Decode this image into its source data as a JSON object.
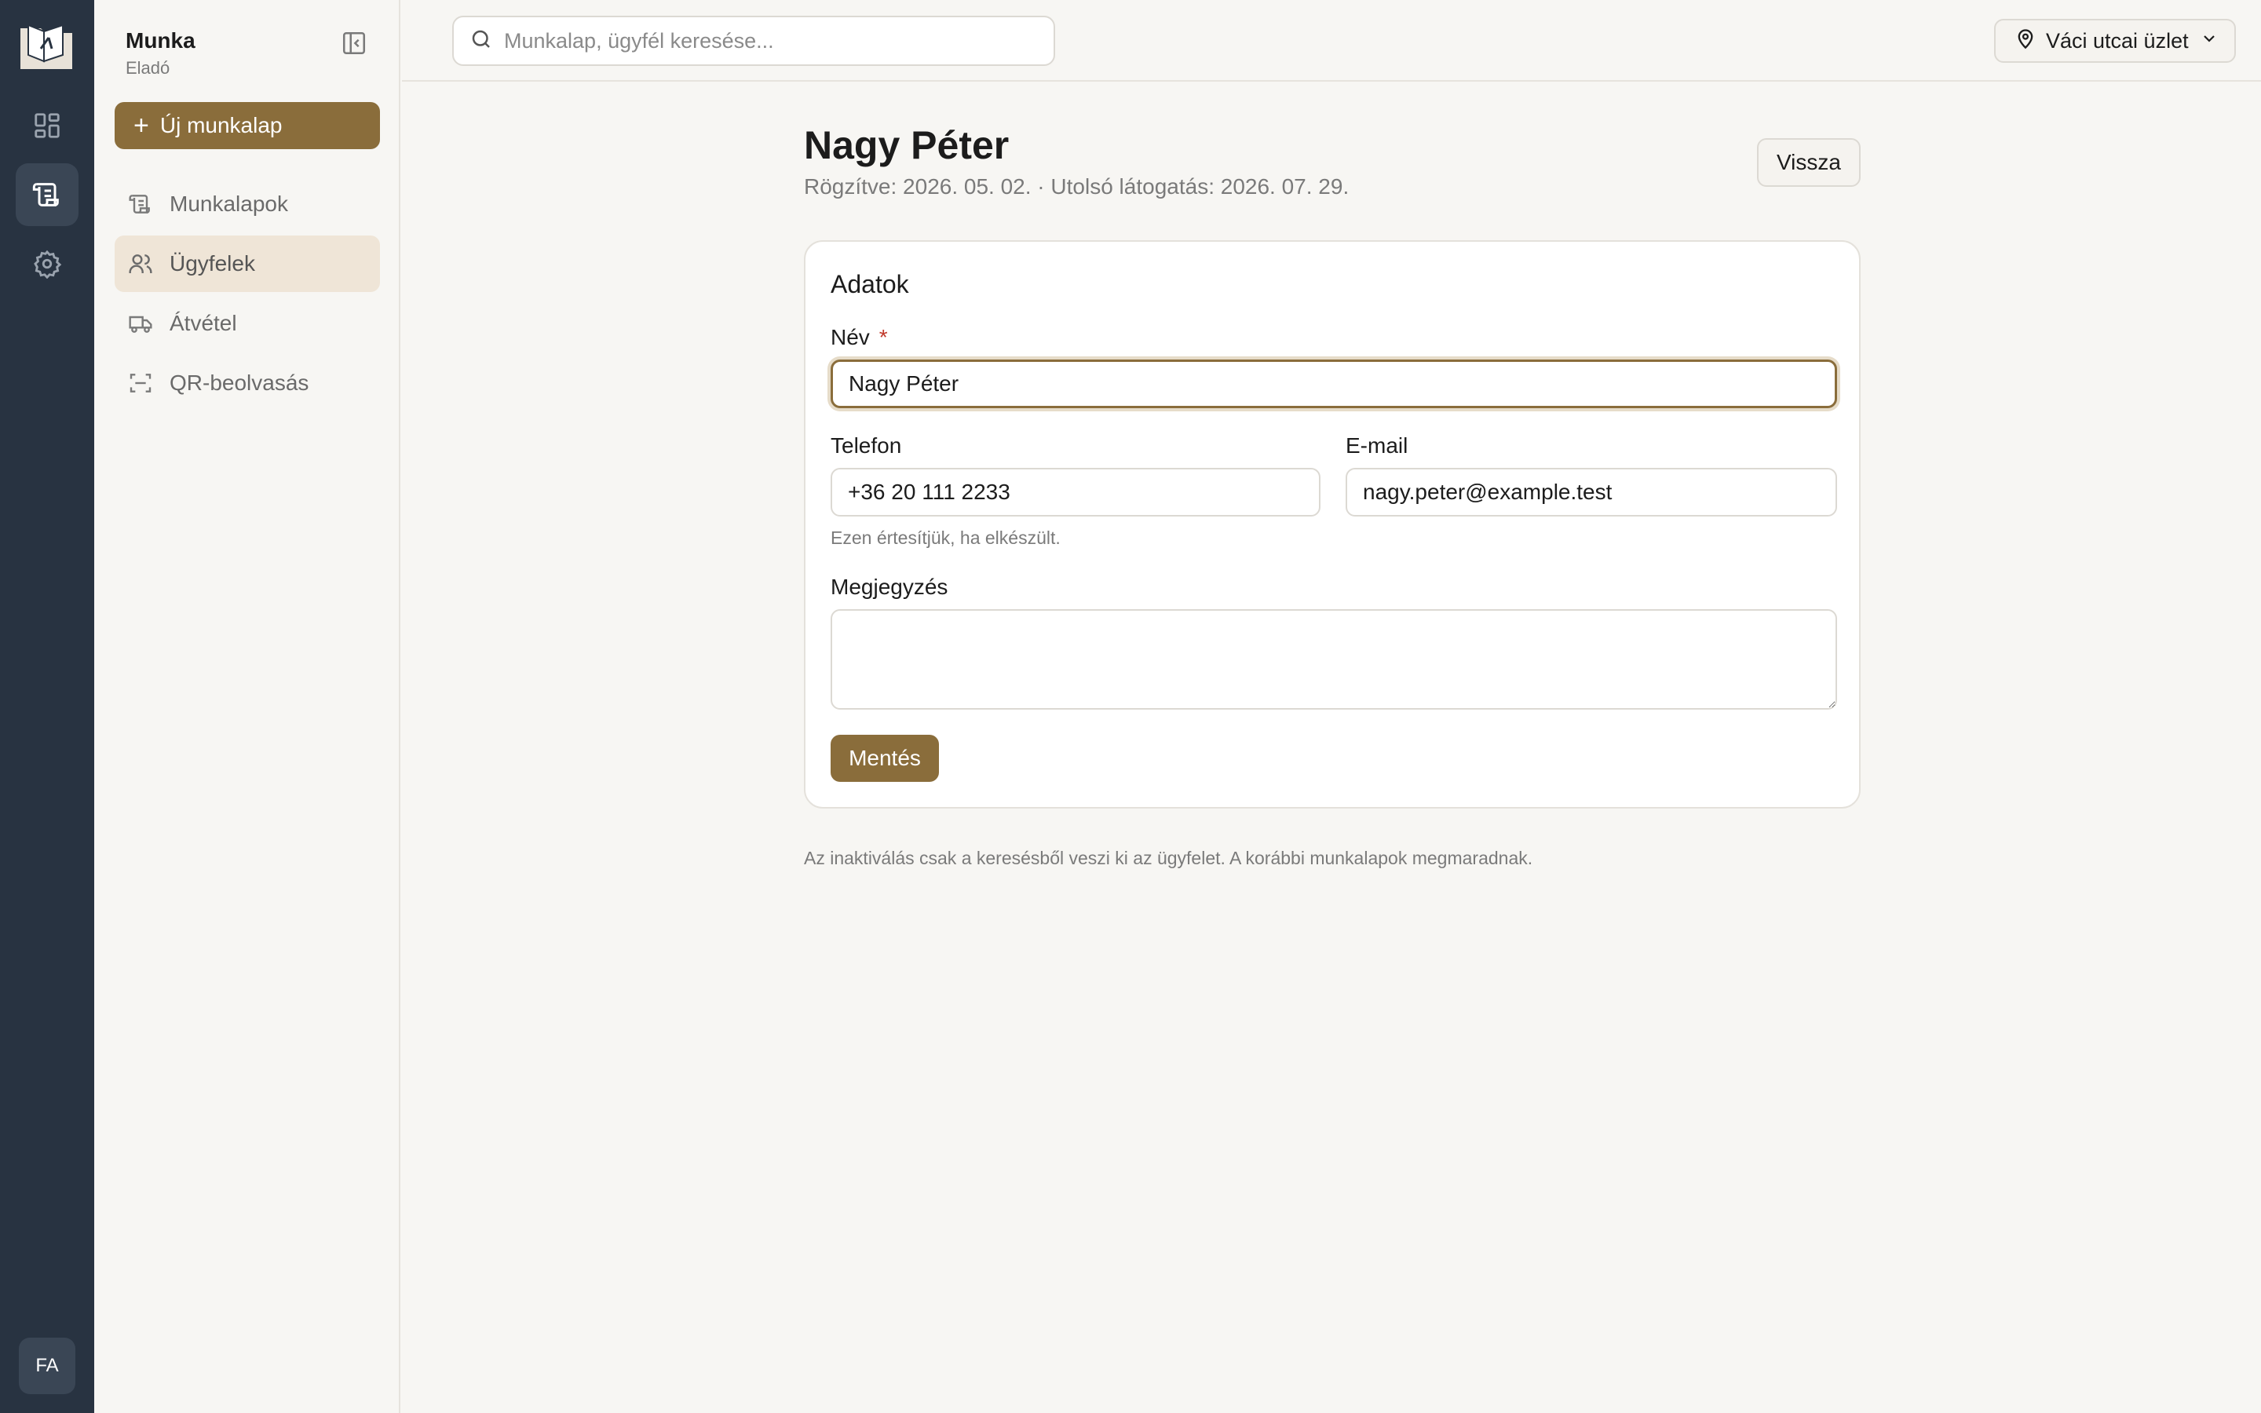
{
  "rail": {
    "avatar_initials": "FA",
    "items": [
      "dashboard-icon",
      "worksheets-icon",
      "settings-icon"
    ]
  },
  "sidebar": {
    "title": "Munka",
    "subtitle": "Eladó",
    "new_button_label": "Új munkalap",
    "items": [
      {
        "label": "Munkalapok",
        "icon": "worksheet-icon",
        "active": false
      },
      {
        "label": "Ügyfelek",
        "icon": "users-icon",
        "active": true
      },
      {
        "label": "Átvétel",
        "icon": "truck-icon",
        "active": false
      },
      {
        "label": "QR-beolvasás",
        "icon": "qr-scan-icon",
        "active": false
      }
    ]
  },
  "topbar": {
    "search_placeholder": "Munkalap, ügyfél keresése...",
    "location": "Váci utcai üzlet"
  },
  "page": {
    "title": "Nagy Péter",
    "meta": "Rögzítve: 2026. 05. 02. · Utolsó látogatás: 2026. 07. 29.",
    "back_label": "Vissza"
  },
  "form": {
    "section_title": "Adatok",
    "name_label": "Név",
    "required_mark": "*",
    "name_value": "Nagy Péter",
    "phone_label": "Telefon",
    "phone_value": "+36 20 111 2233",
    "phone_hint": "Ezen értesítjük, ha elkészült.",
    "email_label": "E-mail",
    "email_value": "nagy.peter@example.test",
    "note_label": "Megjegyzés",
    "note_value": "",
    "save_label": "Mentés"
  },
  "footnote": "Az inaktiválás csak a keresésből veszi ki az ügyfelet. A korábbi munkalapok megmaradnak.",
  "colors": {
    "rail_bg": "#283341",
    "accent": "#8a6d3b",
    "active_nav_bg": "#efe5d7",
    "page_bg": "#f7f6f3"
  }
}
